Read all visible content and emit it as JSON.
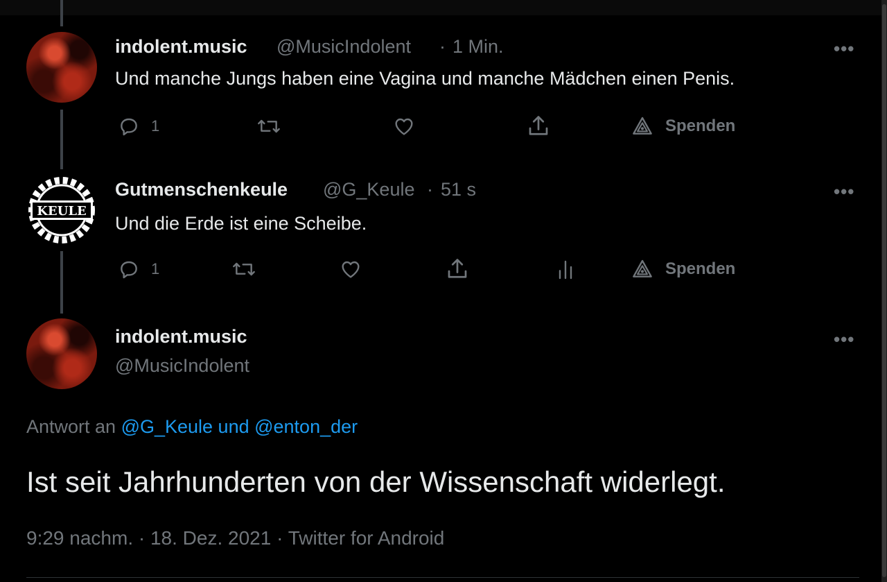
{
  "tweets": [
    {
      "display_name": "indolent.music",
      "handle": "@MusicIndolent",
      "time": "1 Min.",
      "text": "Und manche Jungs haben eine Vagina und manche Mädchen einen Penis.",
      "reply_count": "1",
      "donate_label": "Spenden"
    },
    {
      "display_name": "Gutmenschenkeule",
      "handle": "@G_Keule",
      "time": "51 s",
      "text": "Und die Erde ist eine Scheibe.",
      "reply_count": "1",
      "donate_label": "Spenden",
      "avatar_text": "KEULE"
    }
  ],
  "main_tweet": {
    "display_name": "indolent.music",
    "handle": "@MusicIndolent",
    "reply_prefix": "Antwort an ",
    "reply_targets": "@G_Keule und @enton_der",
    "text": "Ist seit Jahrhunderten von der Wissenschaft widerlegt.",
    "timestamp": "9:29 nachm. · 18. Dez. 2021 · Twitter for Android"
  },
  "separator": "·",
  "more_label": "•••",
  "colors": {
    "background": "#000000",
    "text": "#e7e9ea",
    "secondary": "#71767b",
    "link": "#1d9bf0",
    "thread_line": "#3d4248"
  }
}
